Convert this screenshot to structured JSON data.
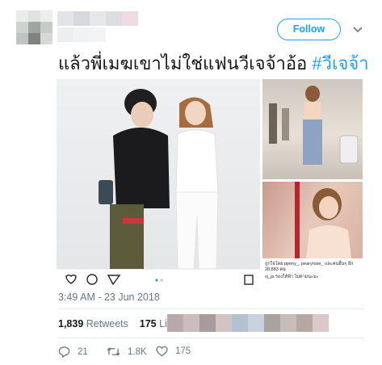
{
  "header": {
    "follow_label": "Follow"
  },
  "tweet": {
    "text": "แล้วพี่เมฆเขาไม่ใช่แฟนวีเจจ้าอ้อ",
    "hashtag": "#วีเจจ้า",
    "timestamp": "3:49 AM - 23 Jun 2018"
  },
  "media": {
    "caption_line1": "ถูกใจโดย ppeny_, pearyrose_ และคนอื่นๆ อีก 28,883 คน",
    "caption_line2": "vj_ja รองให้ฟ้า ไม่ตามนะมะ"
  },
  "stats": {
    "retweets_count": "1,839",
    "retweets_label": "Retweets",
    "likes_count": "175",
    "likes_label": "Likes"
  },
  "actions": {
    "reply_count": "21",
    "retweet_count": "1.8K",
    "like_count": "175"
  },
  "colors": {
    "accent": "#1da1f2",
    "secondary_text": "#657786",
    "primary_text": "#14171a"
  }
}
